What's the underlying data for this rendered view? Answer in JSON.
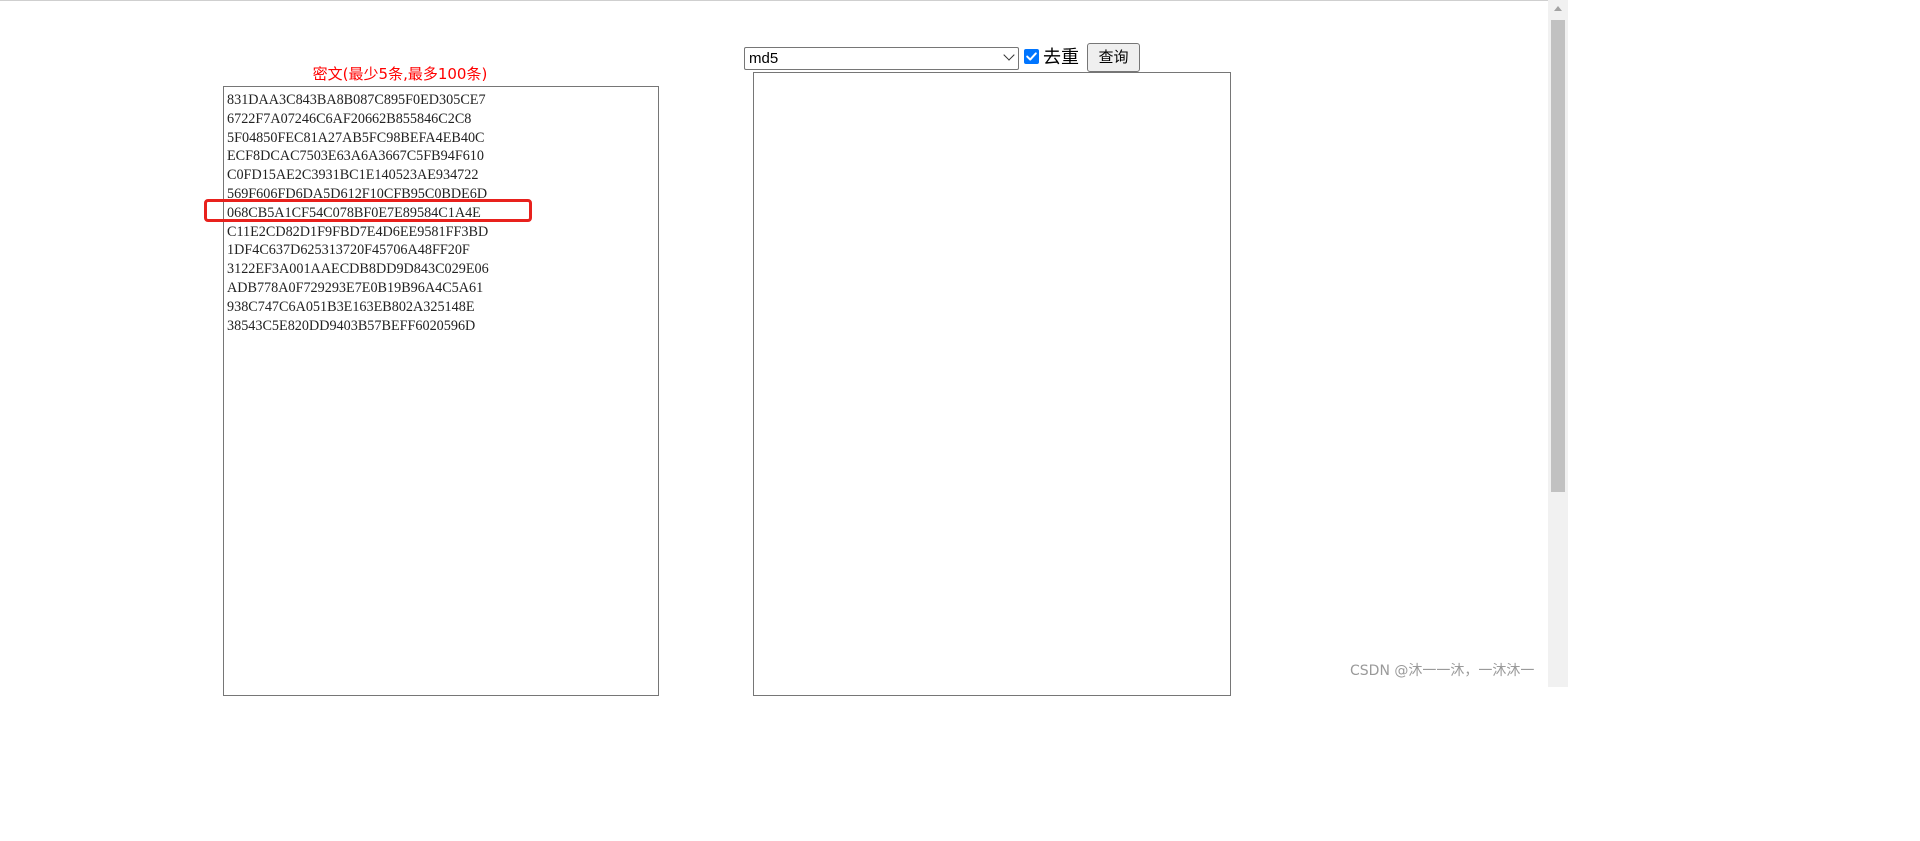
{
  "page": {
    "cipher_label": "密文(最少5条,最多100条)",
    "cipher_lines": [
      "831DAA3C843BA8B087C895F0ED305CE7",
      "6722F7A07246C6AF20662B855846C2C8",
      "5F04850FEC81A27AB5FC98BEFA4EB40C",
      "ECF8DCAC7503E63A6A3667C5FB94F610",
      "C0FD15AE2C3931BC1E140523AE934722",
      "569F606FD6DA5D612F10CFB95C0BDE6D",
      "068CB5A1CF54C078BF0E7E89584C1A4E",
      "C11E2CD82D1F9FBD7E4D6EE9581FF3BD",
      "1DF4C637D625313720F45706A48FF20F",
      "3122EF3A001AAECDB8DD9D843C029E06",
      "ADB778A0F729293E7E0B19B96A4C5A61",
      "938C747C6A051B3E163EB802A325148E",
      "38543C5E820DD9403B57BEFF6020596D"
    ],
    "highlighted_line": "068CB5A1CF54C078BF0E7E89584C1A4E"
  },
  "toolbar": {
    "algorithm_selected": "md5",
    "dedupe_label": "去重",
    "dedupe_checked": true,
    "query_label": "查询"
  },
  "result": {
    "value": ""
  },
  "watermark": "CSDN @沐一一沐，一沐沐一",
  "colors": {
    "label_red": "#ff0000",
    "highlight_red": "#e8211d",
    "checkbox_blue": "#0075ff"
  }
}
